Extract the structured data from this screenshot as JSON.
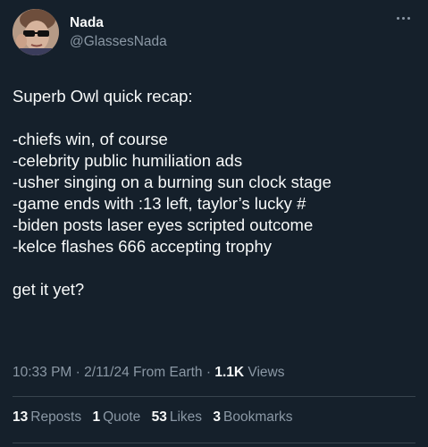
{
  "author": {
    "display_name": "Nada",
    "handle": "@GlassesNada"
  },
  "tweet": {
    "lines": [
      "Superb Owl quick recap:",
      "",
      "-chiefs win, of course",
      "-celebrity public humiliation ads",
      "-usher singing on a burning sun clock stage",
      "-game ends with :13 left, taylor’s lucky #",
      "-biden posts laser eyes scripted outcome",
      "-kelce flashes 666 accepting trophy",
      "",
      "get it yet?"
    ]
  },
  "meta": {
    "time": "10:33 PM",
    "sep1": " · ",
    "date": "2/11/24",
    "source": " From Earth",
    "sep2": " · ",
    "views_count": "1.1K",
    "views_label": " Views"
  },
  "stats": {
    "reposts_count": "13",
    "reposts_label": "Reposts",
    "quotes_count": "1",
    "quotes_label": "Quote",
    "likes_count": "53",
    "likes_label": "Likes",
    "bookmarks_count": "3",
    "bookmarks_label": "Bookmarks"
  },
  "icons": {
    "more": "more-horizontal-icon"
  },
  "colors": {
    "background": "#15202b",
    "text_primary": "#f7f9f9",
    "text_secondary": "#8b98a5",
    "divider": "#38444d"
  }
}
